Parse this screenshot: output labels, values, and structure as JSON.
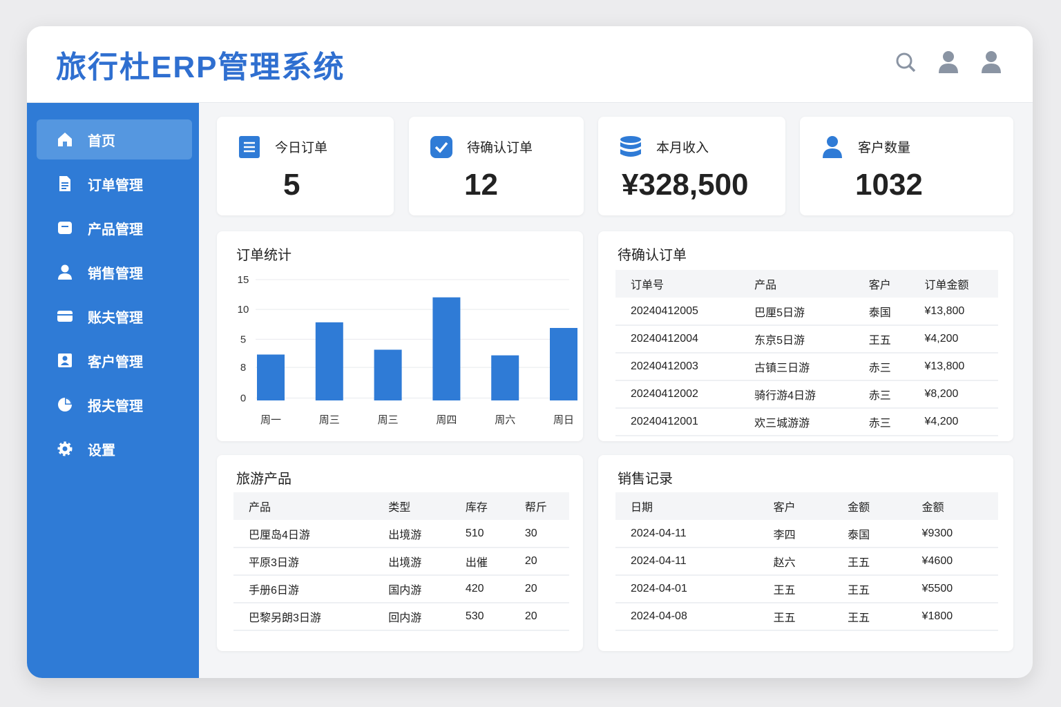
{
  "header": {
    "title": "旅行杜ERP管理系统",
    "icons": [
      "search-icon",
      "user-icon",
      "user-icon"
    ]
  },
  "sidebar": {
    "items": [
      {
        "label": "首页",
        "icon": "home-icon",
        "active": true
      },
      {
        "label": "订单管理",
        "icon": "document-icon"
      },
      {
        "label": "产品管理",
        "icon": "product-icon"
      },
      {
        "label": "销售管理",
        "icon": "user-icon"
      },
      {
        "label": "账夫管理",
        "icon": "card-icon"
      },
      {
        "label": "客户管理",
        "icon": "contact-icon"
      },
      {
        "label": "报夫管理",
        "icon": "pie-chart-icon"
      },
      {
        "label": "设置",
        "icon": "gear-icon"
      }
    ]
  },
  "stats": [
    {
      "label": "今日订单",
      "value": "5",
      "icon": "list-icon"
    },
    {
      "label": "待确认订单",
      "value": "12",
      "icon": "check-icon"
    },
    {
      "label": "本月收入",
      "value": "¥328,500",
      "icon": "database-icon"
    },
    {
      "label": "客户数量",
      "value": "1032",
      "icon": "user-icon"
    }
  ],
  "chart_data": {
    "type": "bar",
    "title": "订单统计",
    "categories": [
      "周一",
      "周三",
      "周三",
      "周四",
      "周六",
      "周日"
    ],
    "values": [
      5.7,
      9.7,
      6.3,
      12.8,
      5.6,
      9.0
    ],
    "ylim": [
      0,
      15
    ],
    "yticks": [
      {
        "label": "15",
        "value": 15
      },
      {
        "label": "10",
        "value": 11.3
      },
      {
        "label": "5",
        "value": 7.6
      },
      {
        "label": "8",
        "value": 4.1
      },
      {
        "label": "0",
        "value": 0.3
      }
    ],
    "color": "#2f7bd6",
    "grid": true
  },
  "pending": {
    "title": "待确认订单",
    "headers": [
      "订单号",
      "产品",
      "客户",
      "订单金额"
    ],
    "rows": [
      [
        "20240412005",
        "巴厘5日游",
        "泰国",
        "¥13,800"
      ],
      [
        "20240412004",
        "东京5日游",
        "王五",
        "¥4,200"
      ],
      [
        "20240412003",
        "古镇三日游",
        "赤三",
        "¥13,800"
      ],
      [
        "20240412002",
        "骑行游4日游",
        "赤三",
        "¥8,200"
      ],
      [
        "20240412001",
        "欢三城游游",
        "赤三",
        "¥4,200"
      ]
    ]
  },
  "products": {
    "title": "旅游产品",
    "headers": [
      "产品",
      "类型",
      "库存",
      "帮斤"
    ],
    "rows": [
      [
        "巴厘岛4日游",
        "出境游",
        "510",
        "30"
      ],
      [
        "平原3日游",
        "出境游",
        "出催",
        "20"
      ],
      [
        "手册6日游",
        "国内游",
        "420",
        "20"
      ],
      [
        "巴黎另朗3日游",
        "回内游",
        "530",
        "20"
      ]
    ]
  },
  "sales": {
    "title": "销售记录",
    "headers": [
      "日期",
      "客户",
      "金额",
      "金额"
    ],
    "rows": [
      [
        "2024-04-11",
        "李四",
        "泰国",
        "¥9300"
      ],
      [
        "2024-04-11",
        "赵六",
        "王五",
        "¥4600"
      ],
      [
        "2024-04-01",
        "王五",
        "王五",
        "¥5500"
      ],
      [
        "2024-04-08",
        "王五",
        "王五",
        "¥1800"
      ]
    ]
  }
}
